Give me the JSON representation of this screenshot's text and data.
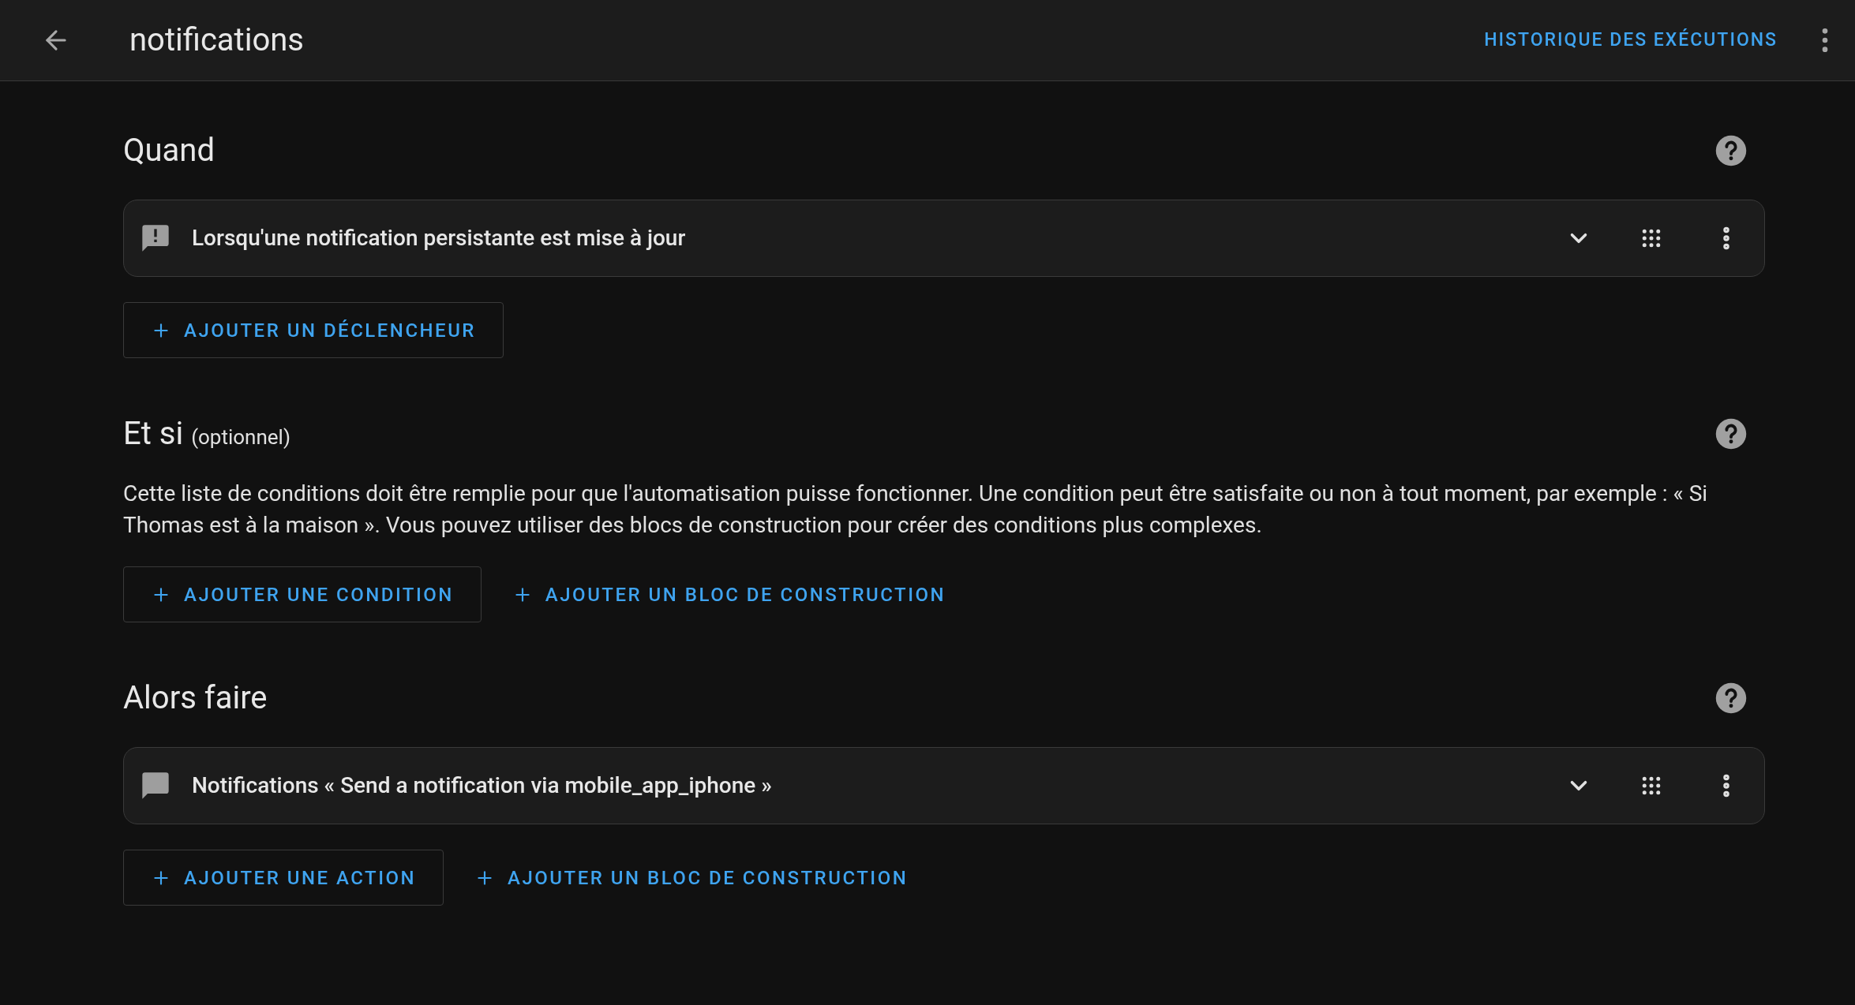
{
  "header": {
    "title": "notifications",
    "action": "HISTORIQUE DES EXÉCUTIONS"
  },
  "sections": [
    {
      "title": "Quand",
      "items": [
        {
          "kind": "alert",
          "label": "Lorsqu'une notification persistante est mise à jour"
        }
      ],
      "buttons": [
        {
          "kind": "outlined",
          "label": "AJOUTER UN DÉCLENCHEUR"
        }
      ]
    },
    {
      "title": "Et si",
      "suffix": "(optionnel)",
      "description": "Cette liste de conditions doit être remplie pour que l'automatisation puisse fonctionner. Une condition peut être satisfaite ou non à tout moment, par exemple : « Si Thomas est à la maison ». Vous pouvez utiliser des blocs de construction pour créer des conditions plus complexes.",
      "buttons": [
        {
          "kind": "outlined",
          "label": "AJOUTER UNE CONDITION"
        },
        {
          "kind": "text",
          "label": "AJOUTER UN BLOC DE CONSTRUCTION"
        }
      ]
    },
    {
      "title": "Alors faire",
      "items": [
        {
          "kind": "message",
          "label": "Notifications « Send a notification via mobile_app_iphone »"
        }
      ],
      "buttons": [
        {
          "kind": "outlined",
          "label": "AJOUTER UNE ACTION"
        },
        {
          "kind": "text",
          "label": "AJOUTER UN BLOC DE CONSTRUCTION"
        }
      ]
    }
  ]
}
